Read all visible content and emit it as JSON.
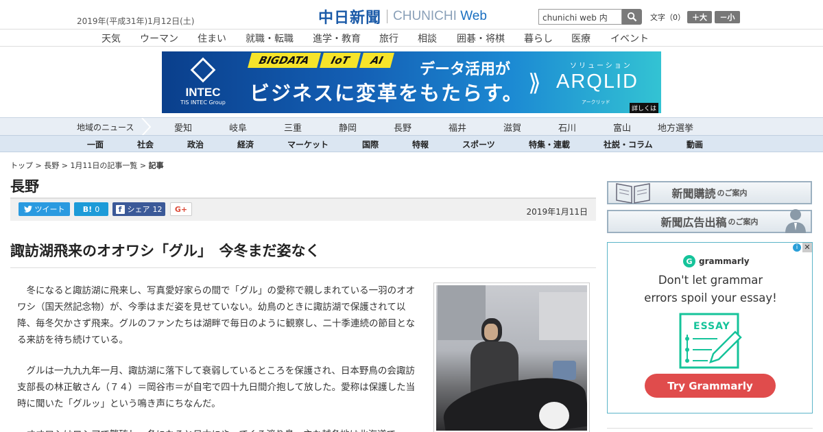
{
  "header": {
    "date": "2019年(平成31年)1月12日(土)",
    "logo_jp": "中日新聞",
    "logo_en_1": "CHUNICHI ",
    "logo_en_2": "Web",
    "search_value": "chunichi web 内",
    "font_size_label": "文字（0）",
    "font_bigger": "＋大",
    "font_smaller": "－小"
  },
  "top_nav": [
    "天気",
    "ウーマン",
    "住まい",
    "就職・転職",
    "進学・教育",
    "旅行",
    "相談",
    "囲碁・将棋",
    "暮らし",
    "医療",
    "イベント"
  ],
  "banner": {
    "brand": "INTEC",
    "brand_sub": "TIS INTEC Group",
    "tags": [
      "BIGDATA",
      "IoT",
      "AI"
    ],
    "line1": "データ活用が",
    "line2": "ビジネスに変革をもたらす。",
    "solution_label": "ソリューション",
    "product": "ARQLID",
    "product_sub": "アークリッド",
    "more": "詳しくは"
  },
  "region_nav": {
    "label": "地域のニュース",
    "items": [
      "愛知",
      "岐阜",
      "三重",
      "静岡",
      "長野",
      "福井",
      "滋賀",
      "石川",
      "富山",
      "地方選挙"
    ]
  },
  "category_nav": [
    "一面",
    "社会",
    "政治",
    "経済",
    "マーケット",
    "国際",
    "特報",
    "スポーツ",
    "特集・連載",
    "社説・コラム",
    "動画"
  ],
  "breadcrumb": {
    "top": "トップ",
    "region": "長野",
    "list": "1月11日の記事一覧",
    "current": "記事",
    "sep": " > "
  },
  "section_title": "長野",
  "share": {
    "tweet": "ツイート",
    "hatena_count": "0",
    "facebook": "シェア",
    "facebook_count": "12",
    "gplus": "G+"
  },
  "article": {
    "date": "2019年1月11日",
    "title": "諏訪湖飛来のオオワシ「グル」　今冬まだ姿なく",
    "paragraphs": [
      "冬になると諏訪湖に飛来し、写真愛好家らの間で「グル」の愛称で親しまれている一羽のオオワシ（国天然記念物）が、今季はまだ姿を見せていない。幼鳥のときに諏訪湖で保護されて以降、毎冬欠かさず飛来。グルのファンたちは湖畔で毎日のように観察し、二十季連続の節目となる来訪を待ち続けている。",
      "グルは一九九九年一月、諏訪湖に落下して衰弱しているところを保護され、日本野鳥の会諏訪支部長の林正敏さん（７４）＝岡谷市＝が自宅で四十九日間介抱して放した。愛称は保護した当時に聞いた「グルッ」という鳴き声にちなんだ。",
      "オオワシはロシアで繁殖し、冬になると日本にやってくる渡り鳥。主な越冬地は北海道で"
    ]
  },
  "sidebar": {
    "subscribe": "新聞購読",
    "subscribe_suffix": "のご案内",
    "ad_submit": "新聞広告出稿",
    "ad_submit_suffix": "のご案内"
  },
  "ad": {
    "brand": "grammarly",
    "headline_1": "Don't let grammar",
    "headline_2": "errors spoil your essay!",
    "essay_label": "ESSAY",
    "cta": "Try Grammarly",
    "close": "✕",
    "info": "i"
  }
}
